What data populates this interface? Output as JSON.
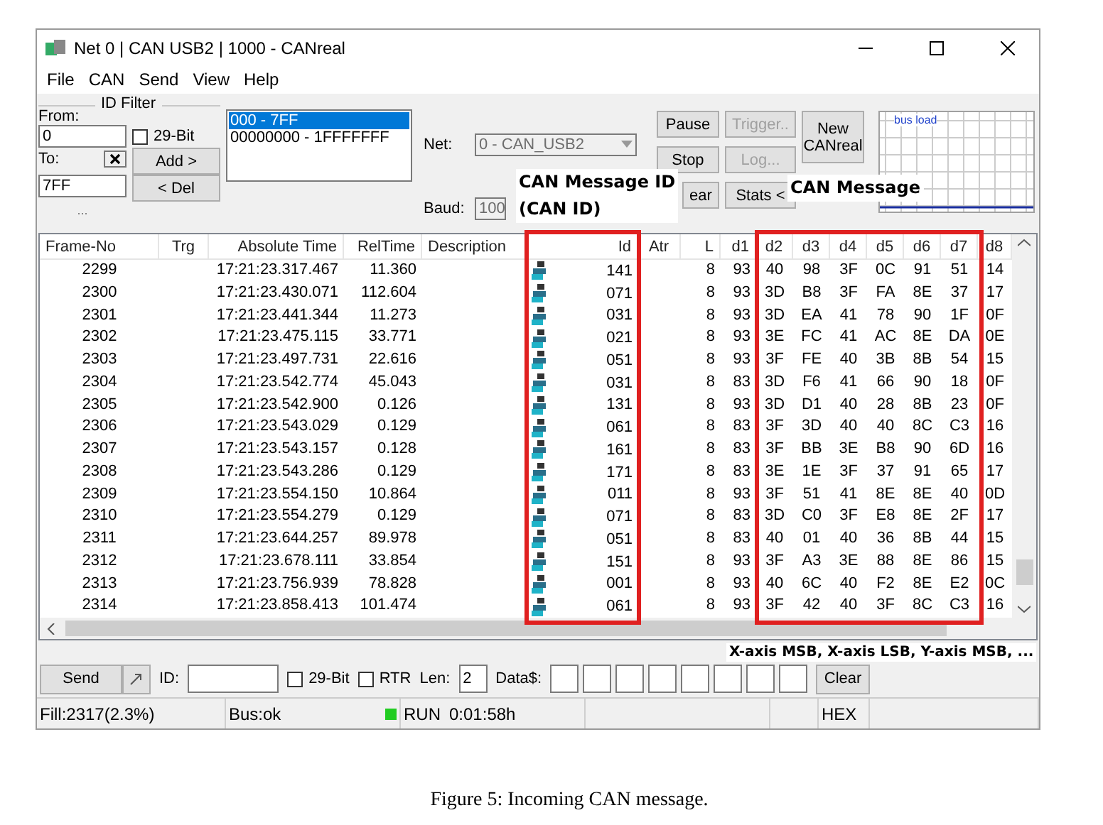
{
  "window": {
    "title": "Net 0 | CAN USB2 | 1000 - CANreal"
  },
  "menu": [
    "File",
    "CAN",
    "Send",
    "View",
    "Help"
  ],
  "id_filter": {
    "title": "ID Filter",
    "from_label": "From:",
    "from": "0",
    "to_label": "To:",
    "to": "7FF",
    "bit29": {
      "label": "29-Bit",
      "checked": false
    },
    "add": "Add >",
    "del": "< Del",
    "more": "..."
  },
  "filter_list": [
    {
      "label": "000 - 7FF",
      "selected": true
    },
    {
      "label": "00000000 - 1FFFFFFF",
      "selected": false
    }
  ],
  "net": {
    "label": "Net:",
    "value": "0 - CAN_USB2",
    "disabled": true
  },
  "baud": {
    "label": "Baud:",
    "value": "100"
  },
  "buttons_col1": [
    {
      "label": "Pause",
      "disabled": false
    },
    {
      "label": "Stop",
      "disabled": false
    },
    {
      "label": "ear",
      "disabled": false
    }
  ],
  "buttons_col2": [
    {
      "label": "Trigger..",
      "disabled": true
    },
    {
      "label": "Log...",
      "disabled": true
    },
    {
      "label": "Stats <",
      "disabled": false
    }
  ],
  "new_button": {
    "line1": "New",
    "line2": "CANreal"
  },
  "bus_load": {
    "title": "bus load"
  },
  "table": {
    "columns": [
      "Frame-No",
      "Trg",
      "Absolute Time",
      "RelTime",
      "Description",
      "Id",
      "Atr",
      "L",
      "d1",
      "d2",
      "d3",
      "d4",
      "d5",
      "d6",
      "d7",
      "d8"
    ],
    "rows": [
      [
        "2299",
        "",
        "17:21:23.317.467",
        "11.360",
        "",
        "141",
        "",
        "8",
        "93",
        "40",
        "98",
        "3F",
        "0C",
        "91",
        "51",
        "14"
      ],
      [
        "2300",
        "",
        "17:21:23.430.071",
        "112.604",
        "",
        "071",
        "",
        "8",
        "93",
        "3D",
        "B8",
        "3F",
        "FA",
        "8E",
        "37",
        "17"
      ],
      [
        "2301",
        "",
        "17:21:23.441.344",
        "11.273",
        "",
        "031",
        "",
        "8",
        "93",
        "3D",
        "EA",
        "41",
        "78",
        "90",
        "1F",
        "0F"
      ],
      [
        "2302",
        "",
        "17:21:23.475.115",
        "33.771",
        "",
        "021",
        "",
        "8",
        "93",
        "3E",
        "FC",
        "41",
        "AC",
        "8E",
        "DA",
        "0E"
      ],
      [
        "2303",
        "",
        "17:21:23.497.731",
        "22.616",
        "",
        "051",
        "",
        "8",
        "93",
        "3F",
        "FE",
        "40",
        "3B",
        "8B",
        "54",
        "15"
      ],
      [
        "2304",
        "",
        "17:21:23.542.774",
        "45.043",
        "",
        "031",
        "",
        "8",
        "83",
        "3D",
        "F6",
        "41",
        "66",
        "90",
        "18",
        "0F"
      ],
      [
        "2305",
        "",
        "17:21:23.542.900",
        "0.126",
        "",
        "131",
        "",
        "8",
        "93",
        "3D",
        "D1",
        "40",
        "28",
        "8B",
        "23",
        "0F"
      ],
      [
        "2306",
        "",
        "17:21:23.543.029",
        "0.129",
        "",
        "061",
        "",
        "8",
        "83",
        "3F",
        "3D",
        "40",
        "40",
        "8C",
        "C3",
        "16"
      ],
      [
        "2307",
        "",
        "17:21:23.543.157",
        "0.128",
        "",
        "161",
        "",
        "8",
        "83",
        "3F",
        "BB",
        "3E",
        "B8",
        "90",
        "6D",
        "16"
      ],
      [
        "2308",
        "",
        "17:21:23.543.286",
        "0.129",
        "",
        "171",
        "",
        "8",
        "83",
        "3E",
        "1E",
        "3F",
        "37",
        "91",
        "65",
        "17"
      ],
      [
        "2309",
        "",
        "17:21:23.554.150",
        "10.864",
        "",
        "011",
        "",
        "8",
        "93",
        "3F",
        "51",
        "41",
        "8E",
        "8E",
        "40",
        "0D"
      ],
      [
        "2310",
        "",
        "17:21:23.554.279",
        "0.129",
        "",
        "071",
        "",
        "8",
        "83",
        "3D",
        "C0",
        "3F",
        "E8",
        "8E",
        "2F",
        "17"
      ],
      [
        "2311",
        "",
        "17:21:23.644.257",
        "89.978",
        "",
        "051",
        "",
        "8",
        "83",
        "40",
        "01",
        "40",
        "36",
        "8B",
        "44",
        "15"
      ],
      [
        "2312",
        "",
        "17:21:23.678.111",
        "33.854",
        "",
        "151",
        "",
        "8",
        "93",
        "3F",
        "A3",
        "3E",
        "88",
        "8E",
        "86",
        "15"
      ],
      [
        "2313",
        "",
        "17:21:23.756.939",
        "78.828",
        "",
        "001",
        "",
        "8",
        "93",
        "40",
        "6C",
        "40",
        "F2",
        "8E",
        "E2",
        "0C"
      ],
      [
        "2314",
        "",
        "17:21:23.858.413",
        "101.474",
        "",
        "061",
        "",
        "8",
        "93",
        "3F",
        "42",
        "40",
        "3F",
        "8C",
        "C3",
        "16"
      ]
    ]
  },
  "send_bar": {
    "send": "Send",
    "id_label": "ID:",
    "bit29": {
      "label": "29-Bit",
      "checked": false
    },
    "rtr": {
      "label": "RTR",
      "checked": false
    },
    "len_label": "Len:",
    "len": "2",
    "data_label": "Data$:",
    "clear": "Clear"
  },
  "status_bar": {
    "fill": "Fill:2317(2.3%)",
    "bus": "Bus:ok",
    "bus_ok": true,
    "run": "RUN",
    "time": "0:01:58h",
    "mode": "HEX"
  },
  "annotations": {
    "id": {
      "line1": "CAN Message ID",
      "line2": "(CAN ID)"
    },
    "message": "CAN Message",
    "axes": "X-axis MSB, X-axis LSB, Y-axis MSB, ..."
  },
  "caption": "Figure 5: Incoming CAN message."
}
